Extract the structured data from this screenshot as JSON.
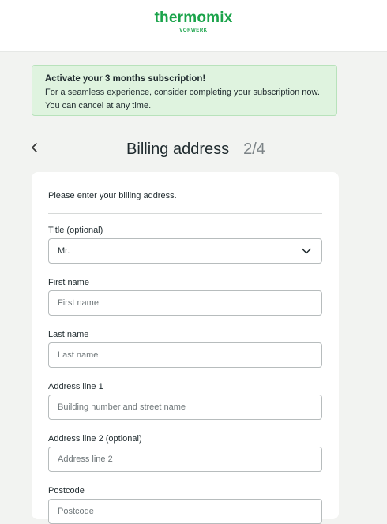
{
  "header": {
    "brand": "thermomix",
    "sub_brand": "VORWERK"
  },
  "banner": {
    "title": "Activate your 3 months subscription!",
    "line1": "For a seamless experience, consider completing your subscription now.",
    "line2": "You can cancel at any time."
  },
  "page": {
    "title": "Billing address",
    "step": "2/4"
  },
  "form": {
    "intro": "Please enter your billing address.",
    "title_field": {
      "label": "Title (optional)",
      "value": "Mr."
    },
    "first_name": {
      "label": "First name",
      "placeholder": "First name"
    },
    "last_name": {
      "label": "Last name",
      "placeholder": "Last name"
    },
    "address1": {
      "label": "Address line 1",
      "placeholder": "Building number and street name"
    },
    "address2": {
      "label": "Address line 2 (optional)",
      "placeholder": "Address line 2"
    },
    "postcode": {
      "label": "Postcode",
      "placeholder": "Postcode"
    }
  },
  "icons": {
    "back": "chevron-left-icon",
    "dropdown": "chevron-down-icon"
  },
  "colors": {
    "brand_green": "#1aa34a",
    "banner_bg": "#dff3df",
    "page_bg": "#f2f3f1"
  }
}
